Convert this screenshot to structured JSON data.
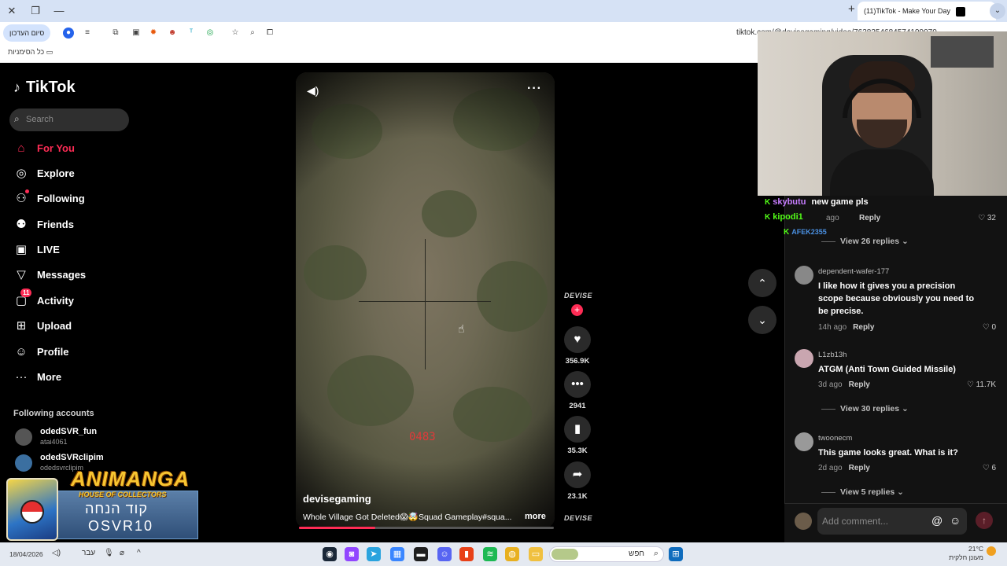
{
  "browser": {
    "tab_title": "(11)TikTok - Make Your Day",
    "end_session_label": "סיום העדכון",
    "url": "tiktok.com/@devisegaming/video/7638254684574199070",
    "all_bookmarks_label": "כל הסימניות"
  },
  "sidebar": {
    "logo": "TikTok",
    "search_placeholder": "Search",
    "items": [
      {
        "label": "For You",
        "icon": "home-icon",
        "active": true
      },
      {
        "label": "Explore",
        "icon": "compass-icon"
      },
      {
        "label": "Following",
        "icon": "following-icon"
      },
      {
        "label": "Friends",
        "icon": "friends-icon"
      },
      {
        "label": "LIVE",
        "icon": "live-icon"
      },
      {
        "label": "Messages",
        "icon": "messages-icon"
      },
      {
        "label": "Activity",
        "icon": "activity-icon",
        "badge": "11"
      },
      {
        "label": "Upload",
        "icon": "upload-icon"
      },
      {
        "label": "Profile",
        "icon": "profile-icon"
      },
      {
        "label": "More",
        "icon": "more-icon"
      }
    ],
    "following_title": "Following accounts",
    "following": [
      {
        "name": "odedSVR_fun",
        "handle": "atai4061"
      },
      {
        "name": "odedSVRclipim",
        "handle": "odedsvrclipim"
      }
    ]
  },
  "ad_overlay": {
    "title": "ANIMANGA",
    "subtitle": "HOUSE OF COLLECTORS",
    "code_label": "קוד הנחה",
    "code": "OSVR10"
  },
  "video": {
    "author": "devisegaming",
    "description": "Whole Village Got Deleted😱🤯Squad Gameplay#squa...",
    "more_label": "more",
    "counter": "0483",
    "progress": 0.3
  },
  "actions": {
    "brand": "DEVISE",
    "likes": "356.9K",
    "comments": "2941",
    "saves": "35.3K",
    "shares": "23.1K"
  },
  "comments": {
    "top_meta_time": "ago",
    "top_reply": "Reply",
    "top_likes": "32",
    "view_replies_1": "View 26 replies",
    "items": [
      {
        "user": "dependent-wafer-177",
        "text": "I like how it gives you a precision scope because obviously you need to be precise.",
        "time": "14h ago",
        "reply": "Reply",
        "likes": "0"
      },
      {
        "user": "L1zb13h",
        "text": "ATGM (Anti Town Guided Missile)",
        "time": "3d ago",
        "reply": "Reply",
        "likes": "11.7K"
      },
      {
        "user": "twoonecm",
        "text": "This game looks great. What is it?",
        "time": "2d ago",
        "reply": "Reply",
        "likes": "6"
      }
    ],
    "view_replies_2": "View 30 replies",
    "view_replies_3": "View 5 replies",
    "add_placeholder": "Add comment..."
  },
  "chat": {
    "lines": [
      {
        "user": "skybutu",
        "msg": "new game pls",
        "color": "#c77dff"
      },
      {
        "user": "kipodi1",
        "msg": "",
        "color": "#53fc18"
      },
      {
        "user": "AFEK2355",
        "msg": "",
        "color": "#4a90e2"
      }
    ]
  },
  "taskbar": {
    "date_left": "18/04/2026",
    "lang": "עבר",
    "search_label": "חפש",
    "temp": "21°C",
    "weather": "מעונן חלקית"
  },
  "colors": {
    "accent": "#fe2c55",
    "kick_green": "#53fc18"
  }
}
